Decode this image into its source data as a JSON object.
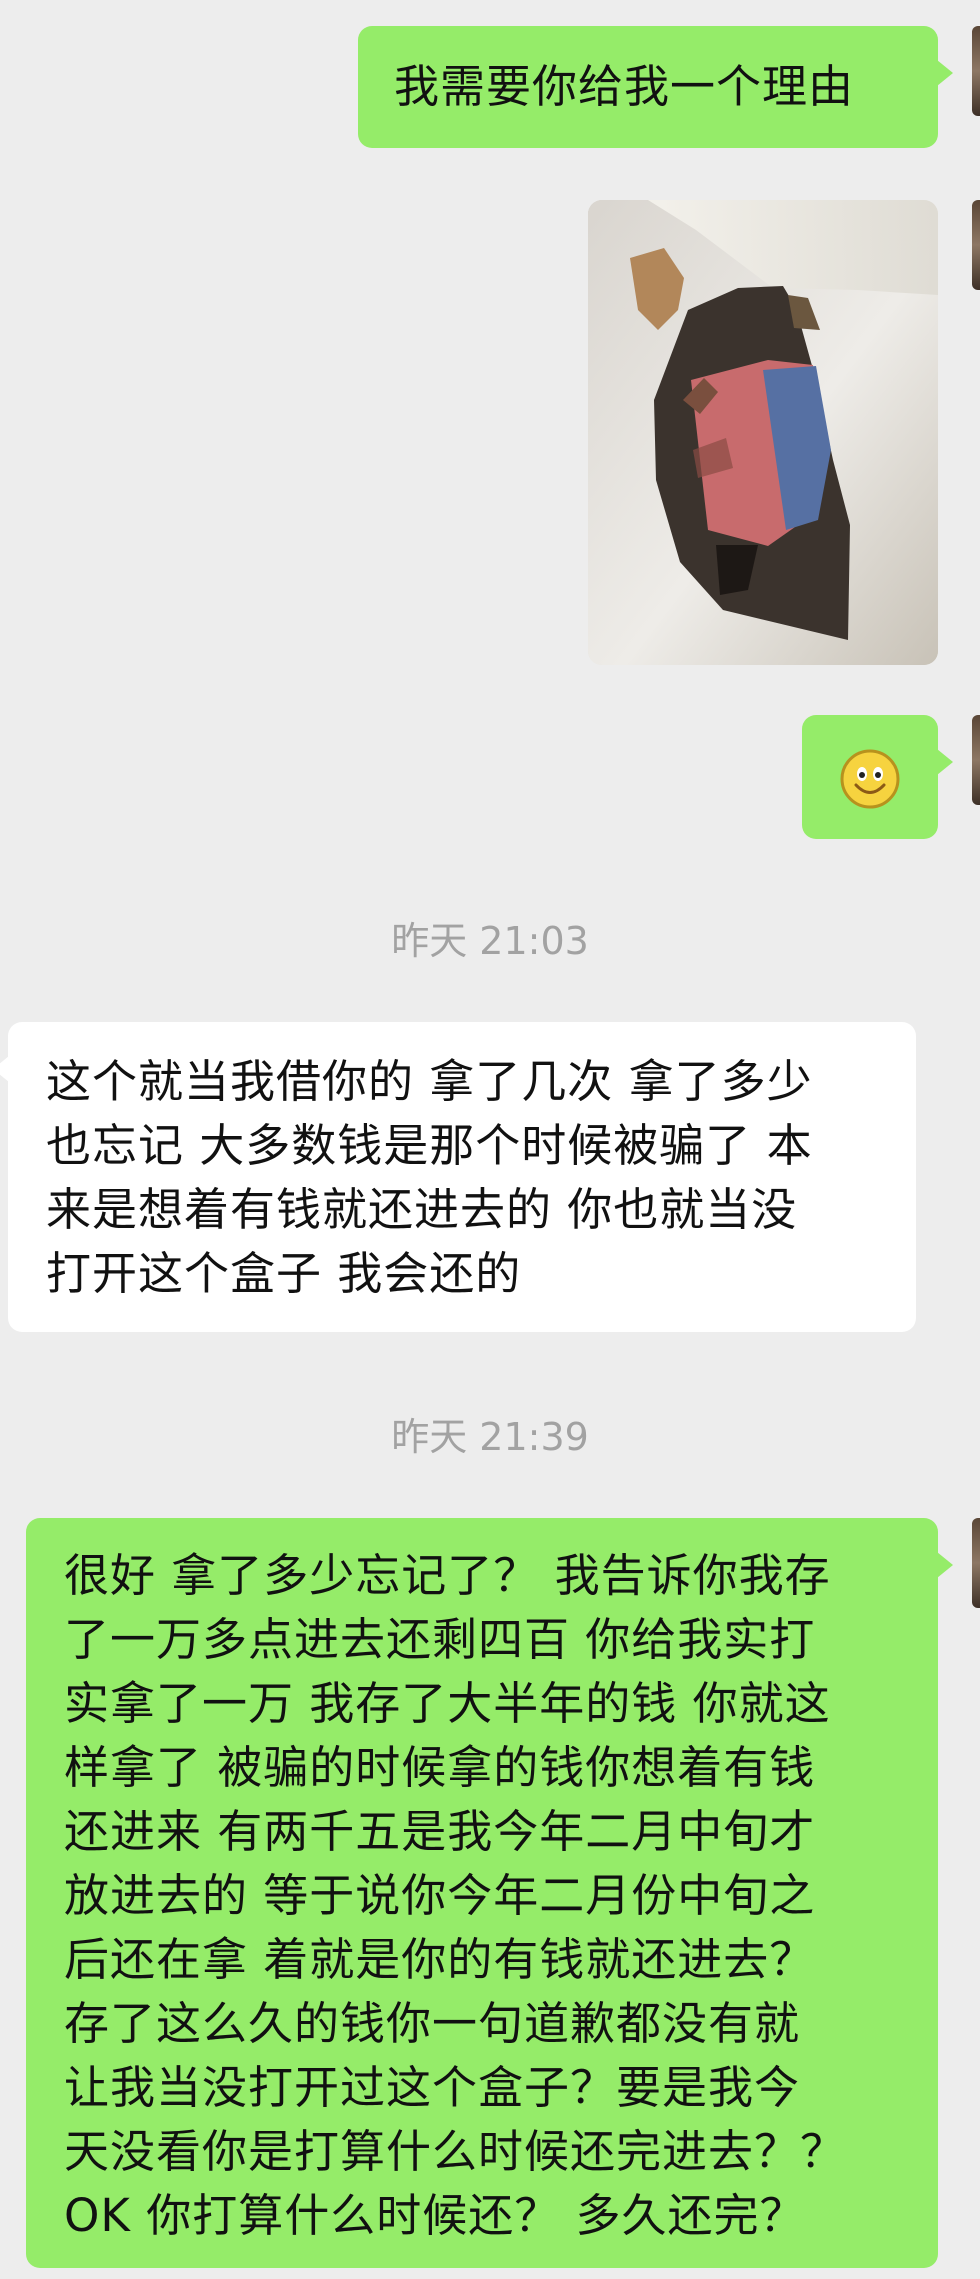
{
  "messages": [
    {
      "side": "out",
      "type": "text",
      "text": "我需要你给我一个理由"
    },
    {
      "side": "out",
      "type": "image",
      "description": "photo"
    },
    {
      "side": "out",
      "type": "emoji",
      "icon": "smile-emoji-icon"
    },
    {
      "type": "timestamp",
      "text": "昨天 21:03"
    },
    {
      "side": "in",
      "type": "text",
      "lines": [
        "这个就当我借你的 拿了几次 拿了多少",
        "也忘记 大多数钱是那个时候被骗了 本",
        "来是想着有钱就还进去的 你也就当没",
        "打开这个盒子 我会还的"
      ]
    },
    {
      "type": "timestamp",
      "text": "昨天 21:39"
    },
    {
      "side": "out",
      "type": "text",
      "lines": [
        "很好 拿了多少忘记了？ 我告诉你我存",
        "了一万多点进去还剩四百 你给我实打",
        "实拿了一万 我存了大半年的钱 你就这",
        "样拿了 被骗的时候拿的钱你想着有钱",
        "还进来 有两千五是我今年二月中旬才",
        "放进去的 等于说你今年二月份中旬之",
        "后还在拿 着就是你的有钱就还进去？",
        "存了这么久的钱你一句道歉都没有就",
        "让我当没打开过这个盒子？要是我今",
        "天没看你是打算什么时候还完进去？？",
        "OK 你打算什么时候还？ 多久还完？"
      ]
    }
  ],
  "colors": {
    "background": "#ededed",
    "outgoing_bubble": "#95ec69",
    "incoming_bubble": "#ffffff",
    "timestamp_text": "#a2a2a2"
  }
}
